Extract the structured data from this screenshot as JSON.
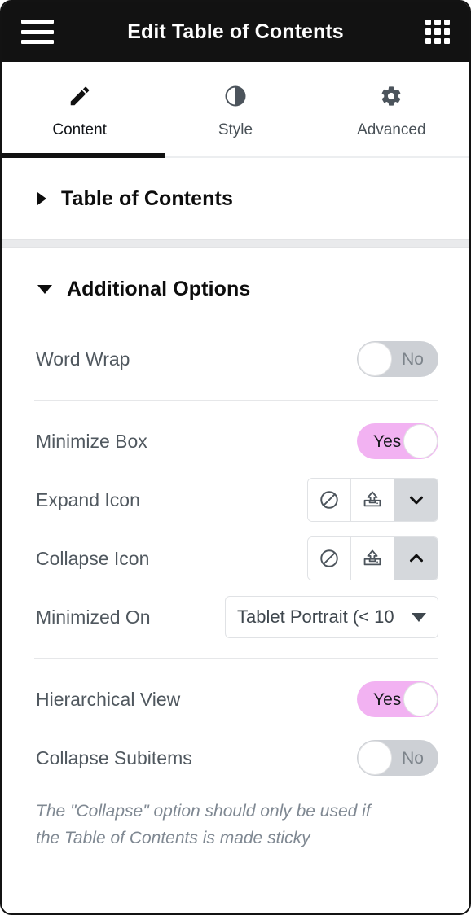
{
  "topbar": {
    "menu_icon": "hamburger-menu-icon",
    "title": "Edit Table of Contents",
    "grid_icon": "apps-grid-icon"
  },
  "tabs": [
    {
      "label": "Content",
      "icon": "pencil-icon",
      "active": true
    },
    {
      "label": "Style",
      "icon": "contrast-icon",
      "active": false
    },
    {
      "label": "Advanced",
      "icon": "gear-icon",
      "active": false
    }
  ],
  "sections": [
    {
      "title": "Table of Contents",
      "expanded": false
    },
    {
      "title": "Additional Options",
      "expanded": true
    }
  ],
  "controls": {
    "word_wrap": {
      "label": "Word Wrap",
      "value": "No",
      "state": "off"
    },
    "minimize_box": {
      "label": "Minimize Box",
      "value": "Yes",
      "state": "on"
    },
    "expand_icon": {
      "label": "Expand Icon",
      "options": [
        "none-icon",
        "upload-icon",
        "chevron-down-icon"
      ],
      "selected_index": 2
    },
    "collapse_icon": {
      "label": "Collapse Icon",
      "options": [
        "none-icon",
        "upload-icon",
        "chevron-up-icon"
      ],
      "selected_index": 2
    },
    "minimized_on": {
      "label": "Minimized On",
      "value": "Tablet Portrait (< 10"
    },
    "hierarchical_view": {
      "label": "Hierarchical View",
      "value": "Yes",
      "state": "on"
    },
    "collapse_subitems": {
      "label": "Collapse Subitems",
      "value": "No",
      "state": "off"
    },
    "collapse_note": "The \"Collapse\" option should only be used if the Table of Contents is made sticky"
  },
  "colors": {
    "topbar_bg": "#121212",
    "toggle_on": "#f2b2f2",
    "toggle_off": "#cdd0d5",
    "label_text": "#50585f",
    "title_text": "#0d0d0d",
    "selected_icon_bg": "#d5d8dc"
  }
}
